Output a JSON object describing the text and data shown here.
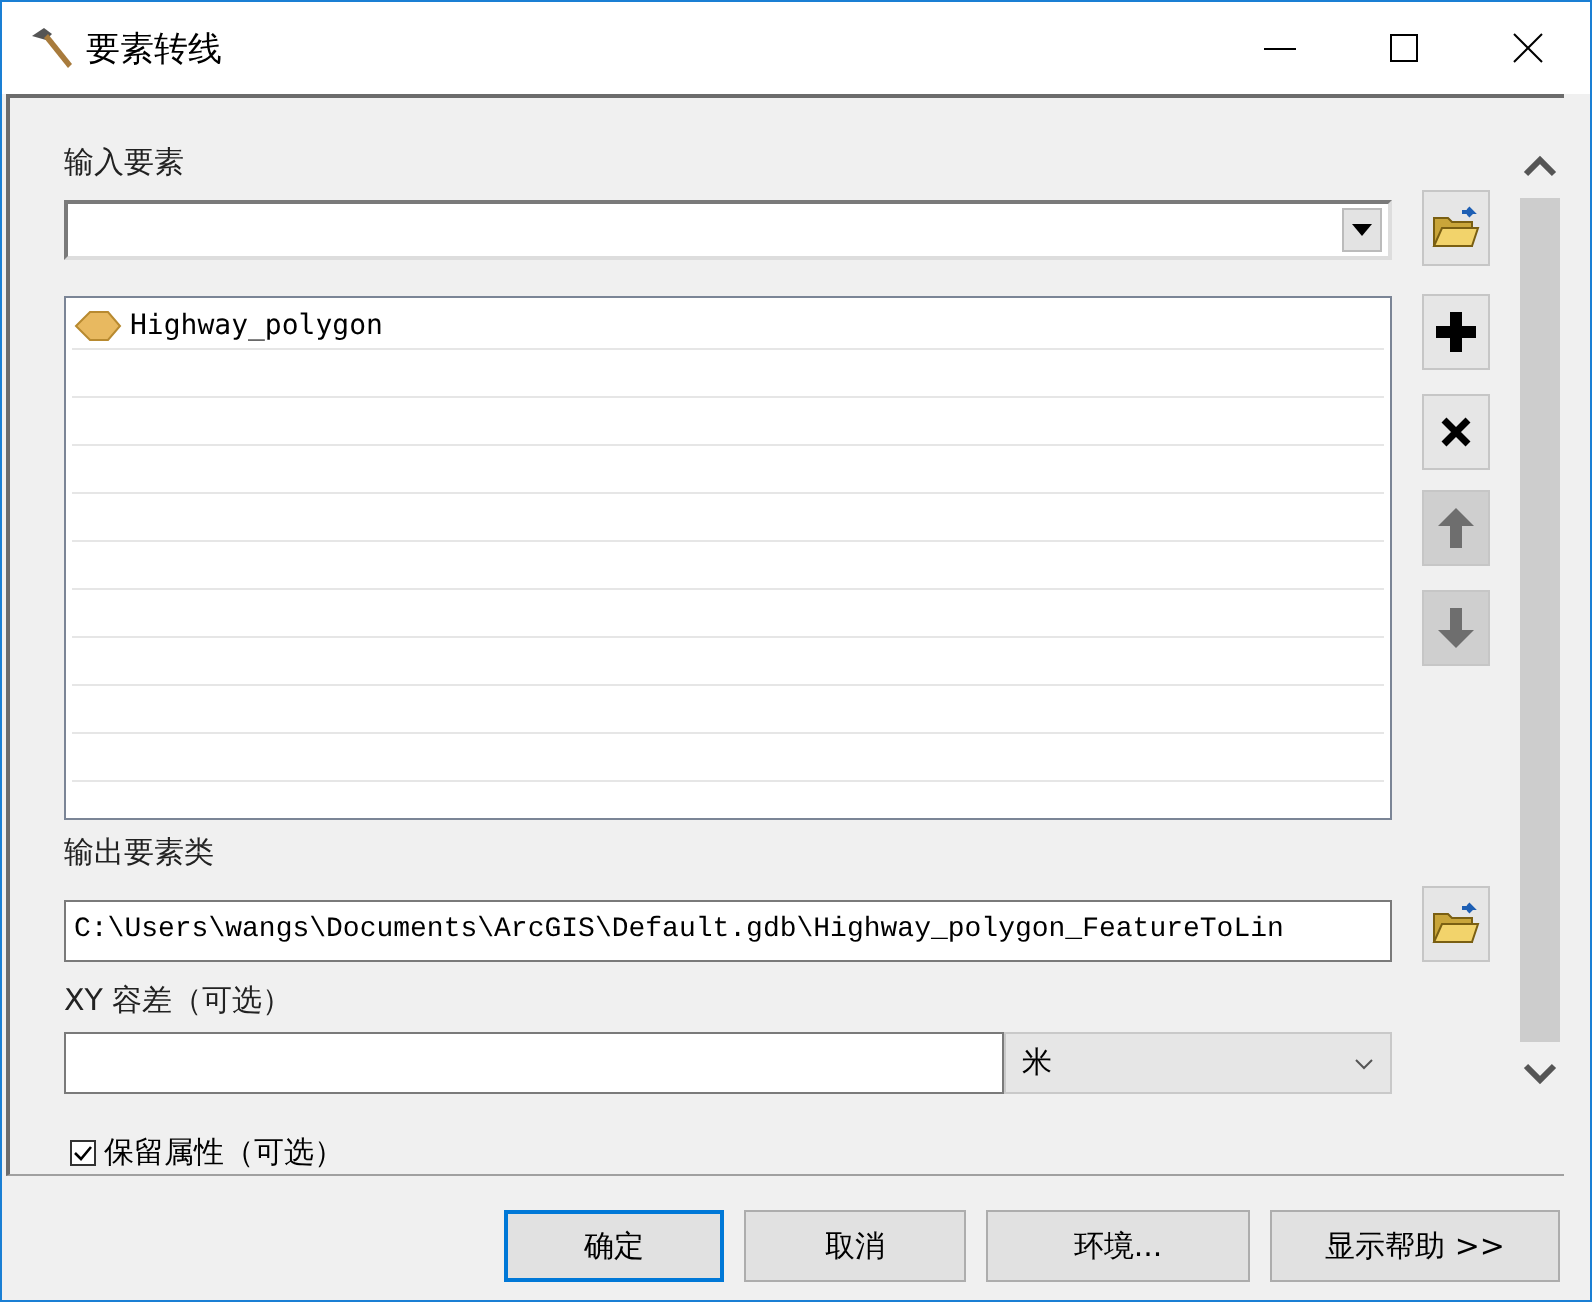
{
  "window": {
    "title": "要素转线"
  },
  "input_features": {
    "label": "输入要素"
  },
  "feature_list": {
    "items": [
      {
        "label": "Highway_polygon"
      }
    ]
  },
  "list_buttons": [
    {
      "kind": "add",
      "disabled": false
    },
    {
      "kind": "remove",
      "disabled": false
    },
    {
      "kind": "up",
      "disabled": true
    },
    {
      "kind": "down",
      "disabled": true
    }
  ],
  "output_feature_class": {
    "label": "输出要素类",
    "value": "C:\\Users\\wangs\\Documents\\ArcGIS\\Default.gdb\\Highway_polygon_FeatureToLin"
  },
  "xy_tolerance": {
    "label": "XY 容差（可选）",
    "unit": "米"
  },
  "preserve_attributes": {
    "label": "保留属性（可选）",
    "checked": true
  },
  "buttons": [
    {
      "label": "确定",
      "focused": true
    },
    {
      "label": "取消",
      "focused": false
    },
    {
      "label": "环境...",
      "focused": false
    },
    {
      "label": "显示帮助 >>",
      "focused": false
    }
  ]
}
